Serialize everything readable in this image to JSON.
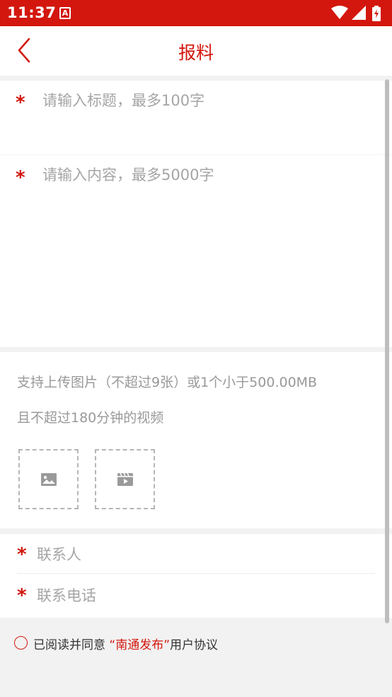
{
  "status_bar": {
    "time": "11:37",
    "app_icon_letter": "A",
    "icons": [
      "wifi-icon",
      "signal-icon",
      "battery-charging-icon"
    ]
  },
  "header": {
    "title": "报料",
    "back_icon": "chevron-left-icon"
  },
  "form": {
    "title_placeholder": "请输入标题，最多100字",
    "content_placeholder": "请输入内容，最多5000字",
    "required_mark": "*",
    "media_hint_line1": "支持上传图片（不超过9张）或1个小于500.00MB",
    "media_hint_line2": "且不超过180分钟的视频",
    "upload_image_icon": "image-icon",
    "upload_video_icon": "video-icon",
    "contact_name_placeholder": "联系人",
    "contact_phone_placeholder": "联系电话"
  },
  "agreement": {
    "prefix": "已阅读并同意 ",
    "link": "“南通发布”",
    "suffix": "用户协议",
    "checked": false
  },
  "colors": {
    "accent": "#d3170e",
    "placeholder": "#a5a5a5",
    "background": "#f2f2f2"
  }
}
